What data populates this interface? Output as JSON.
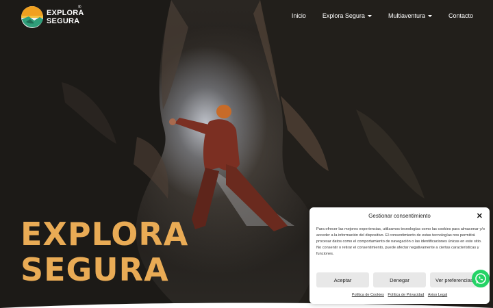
{
  "brand": {
    "name_line1": "EXPLORA",
    "name_line2": "SEGURA",
    "registered": "®"
  },
  "nav": {
    "items": [
      {
        "label": "Inicio",
        "has_caret": false
      },
      {
        "label": "Explora Segura",
        "has_caret": true
      },
      {
        "label": "Multiaventura",
        "has_caret": true
      },
      {
        "label": "Contacto",
        "has_caret": false
      }
    ]
  },
  "hero": {
    "title_line1": "EXPLORA",
    "title_line2": "SEGURA",
    "title_color": "#e9ab55"
  },
  "consent": {
    "title": "Gestionar consentimiento",
    "body": "Para ofrecer las mejores experiencias, utilizamos tecnologías como las cookies para almacenar y/o acceder a la información del dispositivo. El consentimiento de estas tecnologías nos permitirá procesar datos como el comportamiento de navegación o las identificaciones únicas en este sitio. No consentir o retirar el consentimiento, puede afectar negativamente a ciertas características y funciones.",
    "accept_label": "Aceptar",
    "deny_label": "Denegar",
    "prefs_label": "Ver preferencias",
    "links": [
      "Política de Cookies",
      "Política de Privacidad",
      "Aviso Legal"
    ]
  },
  "colors": {
    "accent": "#e9ab55",
    "whatsapp": "#25d366"
  },
  "icons": {
    "close": "close-icon",
    "whatsapp": "whatsapp-icon",
    "logo": "logo-icon"
  }
}
